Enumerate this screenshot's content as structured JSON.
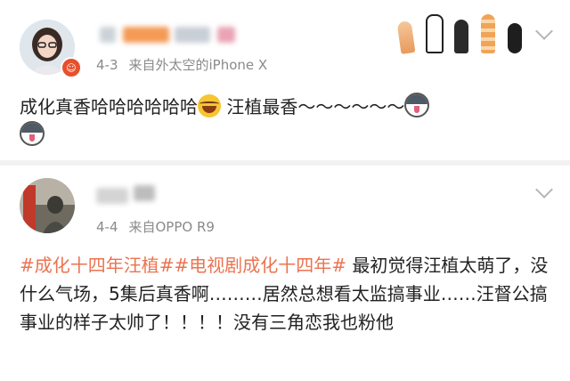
{
  "posts": [
    {
      "date": "4-3",
      "source": "来自外太空的iPhone X",
      "badge_glyph": "☺",
      "text_part1": "成化真香哈哈哈哈哈哈",
      "text_part2": " 汪植最香～～～～～～",
      "emojis": [
        "laughing-tears-emoji",
        "husky-emoji",
        "husky-emoji"
      ],
      "decoration": "cat-paws-sticker"
    },
    {
      "date": "4-4",
      "source": "来自OPPO R9",
      "hashtags": [
        "#成化十四年汪植#",
        "#电视剧成化十四年#"
      ],
      "text": " 最初觉得汪植太萌了，没什么气场，5集后真香啊………居然总想看太监搞事业……汪督公搞事业的样子太帅了！！！！没有三角恋我也粉他"
    }
  ],
  "colors": {
    "hashtag": "#eb7350",
    "meta": "#8a8a8a",
    "text": "#222222",
    "divider": "#f2f2f2"
  },
  "icons": {
    "more": "chevron-down-icon",
    "badge": "vip-badge-icon"
  }
}
